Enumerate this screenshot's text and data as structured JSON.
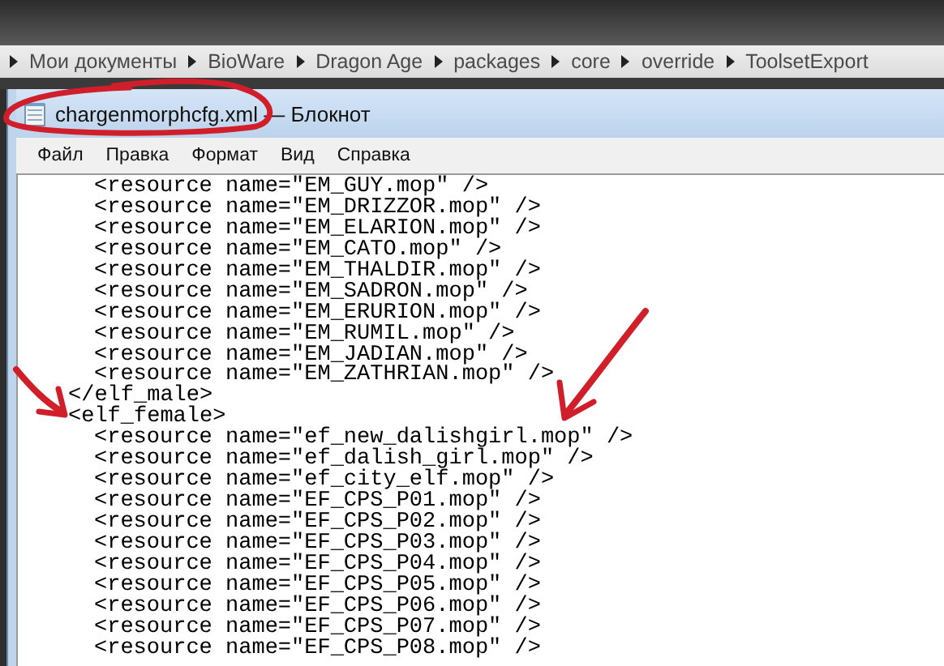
{
  "breadcrumb": [
    "Мои документы",
    "BioWare",
    "Dragon Age",
    "packages",
    "core",
    "override",
    "ToolsetExport"
  ],
  "window": {
    "file_name": "chargenmorphcfg.xml",
    "separator": "—",
    "app_name": "Блокнот"
  },
  "menu": [
    "Файл",
    "Правка",
    "Формат",
    "Вид",
    "Справка"
  ],
  "editor": {
    "blocks": [
      {
        "items": [
          "<resource name=\"EM_GUY.mop\" />",
          "<resource name=\"EM_DRIZZOR.mop\" />",
          "<resource name=\"EM_ELARION.mop\" />",
          "<resource name=\"EM_CATO.mop\" />",
          "<resource name=\"EM_THALDIR.mop\" />",
          "<resource name=\"EM_SADRON.mop\" />",
          "<resource name=\"EM_ERURION.mop\" />",
          "<resource name=\"EM_RUMIL.mop\" />",
          "<resource name=\"EM_JADIAN.mop\" />",
          "<resource name=\"EM_ZATHRIAN.mop\" />"
        ],
        "closing": "</elf_male>"
      },
      {
        "opening": "<elf_female>",
        "items": [
          "<resource name=\"ef_new_dalishgirl.mop\" />",
          "<resource name=\"ef_dalish_girl.mop\" />",
          "<resource name=\"ef_city_elf.mop\" />",
          "<resource name=\"EF_CPS_P01.mop\" />",
          "<resource name=\"EF_CPS_P02.mop\" />",
          "<resource name=\"EF_CPS_P03.mop\" />",
          "<resource name=\"EF_CPS_P04.mop\" />",
          "<resource name=\"EF_CPS_P05.mop\" />",
          "<resource name=\"EF_CPS_P06.mop\" />",
          "<resource name=\"EF_CPS_P07.mop\" />",
          "<resource name=\"EF_CPS_P08.mop\" />"
        ]
      }
    ]
  }
}
